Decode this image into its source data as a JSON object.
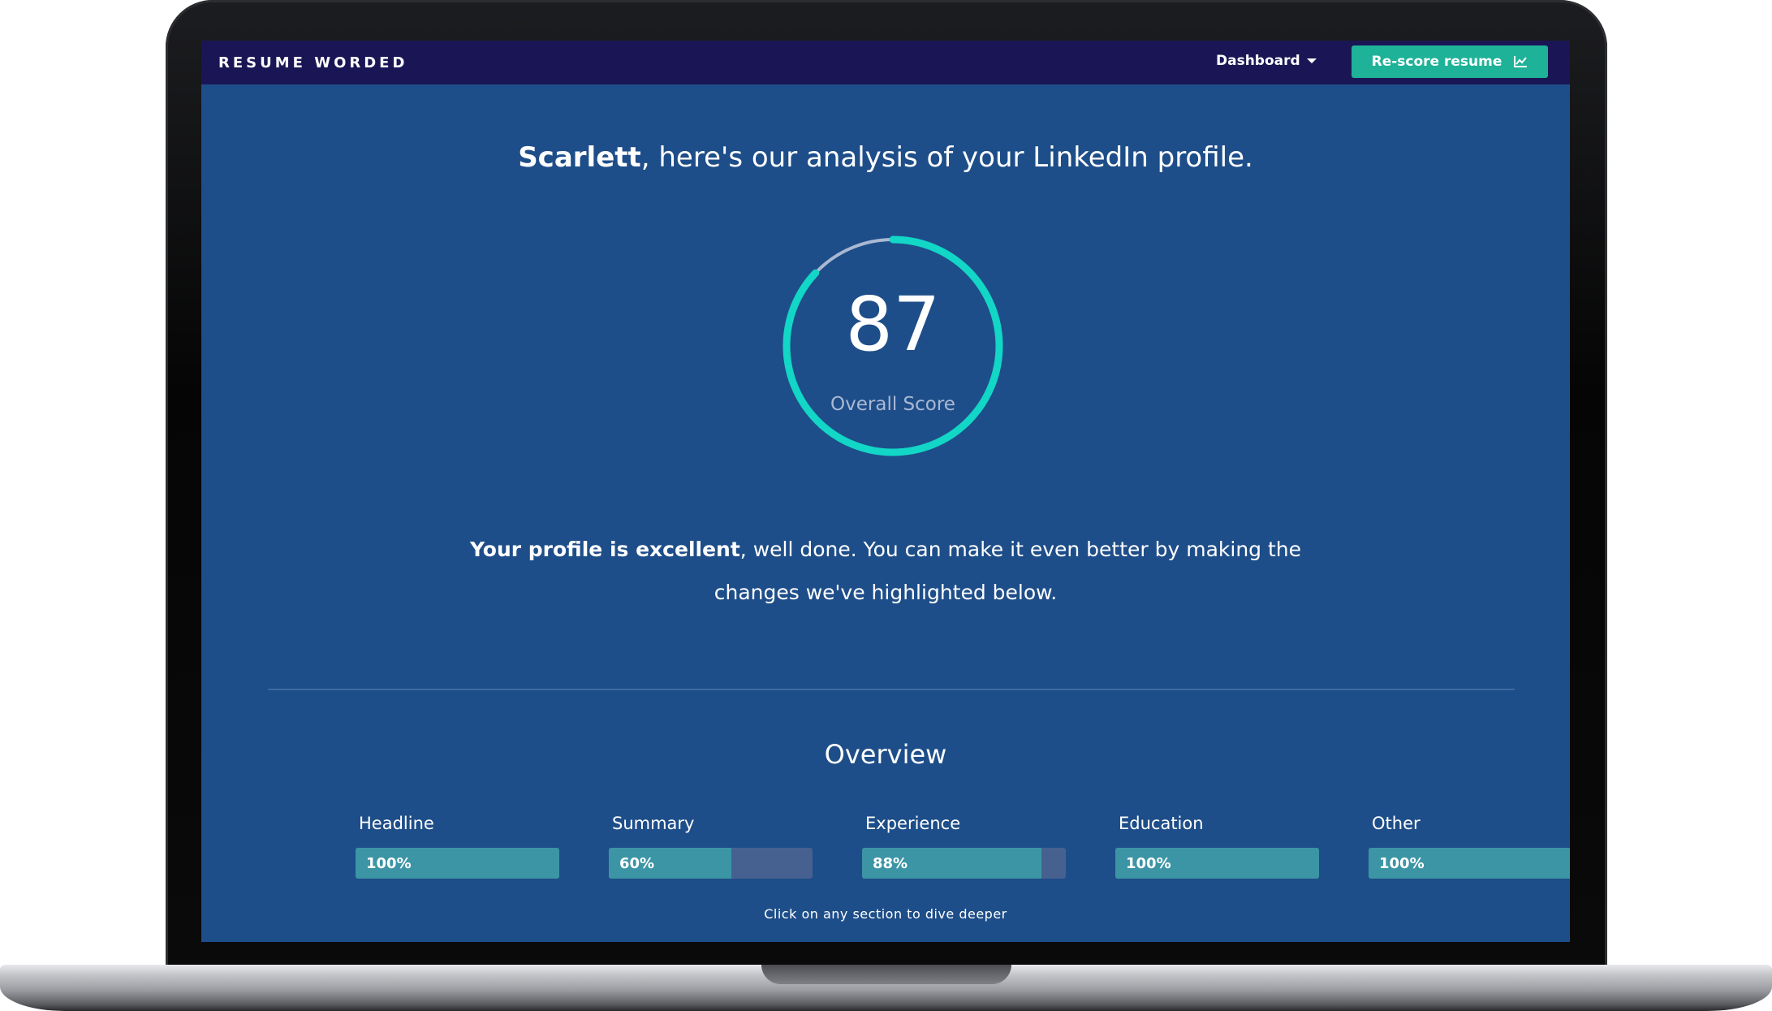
{
  "app": {
    "brand": "RESUME WORDED"
  },
  "nav": {
    "dashboard_label": "Dashboard",
    "rescore_label": "Re-score resume",
    "rescore_icon": "line-chart-icon"
  },
  "headline": {
    "name": "Scarlett",
    "rest": ", here's our analysis of your LinkedIn profile."
  },
  "score": {
    "value": "87",
    "label": "Overall Score",
    "fraction": 0.87
  },
  "summary": {
    "bold": "Your profile is excellent",
    "line1_rest": ", well done. You can make it even better by making the",
    "line2": "changes we've highlighted below."
  },
  "overview": {
    "title": "Overview",
    "sections": [
      {
        "label": "Headline",
        "value": "100%",
        "fraction": 1.0
      },
      {
        "label": "Summary",
        "value": "60%",
        "fraction": 0.6
      },
      {
        "label": "Experience",
        "value": "88%",
        "fraction": 0.88
      },
      {
        "label": "Education",
        "value": "100%",
        "fraction": 1.0
      },
      {
        "label": "Other",
        "value": "100%",
        "fraction": 1.0
      }
    ],
    "hint": "Click on any section to dive deeper"
  },
  "colors": {
    "navbar": "#1a1655",
    "page_background": "#1e4e89",
    "accent": "#1eb298",
    "gauge_progress": "#12d6c6",
    "gauge_track": "#a9b9d3",
    "bar_fill": "#3c95a5",
    "bar_track": "#46618f"
  }
}
